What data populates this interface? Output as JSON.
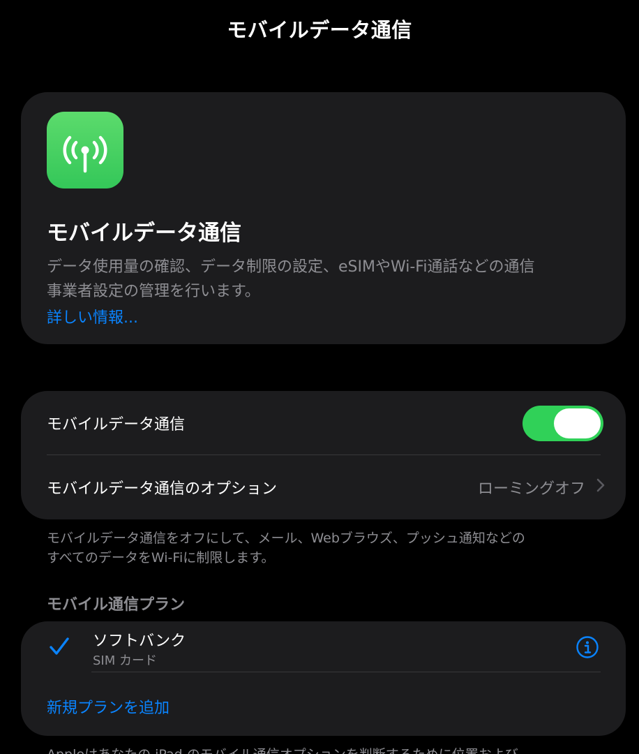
{
  "nav": {
    "title": "モバイルデータ通信"
  },
  "hero": {
    "icon": "cellular-antenna-icon",
    "title": "モバイルデータ通信",
    "description_line1": "データ使用量の確認、データ制限の設定、eSIMやWi-Fi通話などの通信",
    "description_line2": "事業者設定の管理を行います。",
    "link": "詳しい情報..."
  },
  "settings": {
    "cellular_data_label": "モバイルデータ通信",
    "cellular_data_on": true,
    "options_label": "モバイルデータ通信のオプション",
    "options_value": "ローミングオフ",
    "chevron": "chevron-right-icon"
  },
  "footnote": {
    "line1": "モバイルデータ通信をオフにして、メール、Webブラウズ、プッシュ通知などの",
    "line2": "すべてのデータをWi-Fiに制限します。"
  },
  "plans": {
    "header": "モバイル通信プラン",
    "items": [
      {
        "name": "ソフトバンク",
        "type": "SIM カード",
        "selected": true
      }
    ],
    "add_label": "新規プランを追加"
  },
  "bottom_text": "Appleはあなたの iPad のモバイル通信オプションを判断するために位置および",
  "colors": {
    "background": "#000000",
    "card": "#1c1c1e",
    "accent": "#0a84ff",
    "toggle_on": "#30d158",
    "icon_green": "#34c759",
    "secondary_text": "#8e8e93"
  }
}
